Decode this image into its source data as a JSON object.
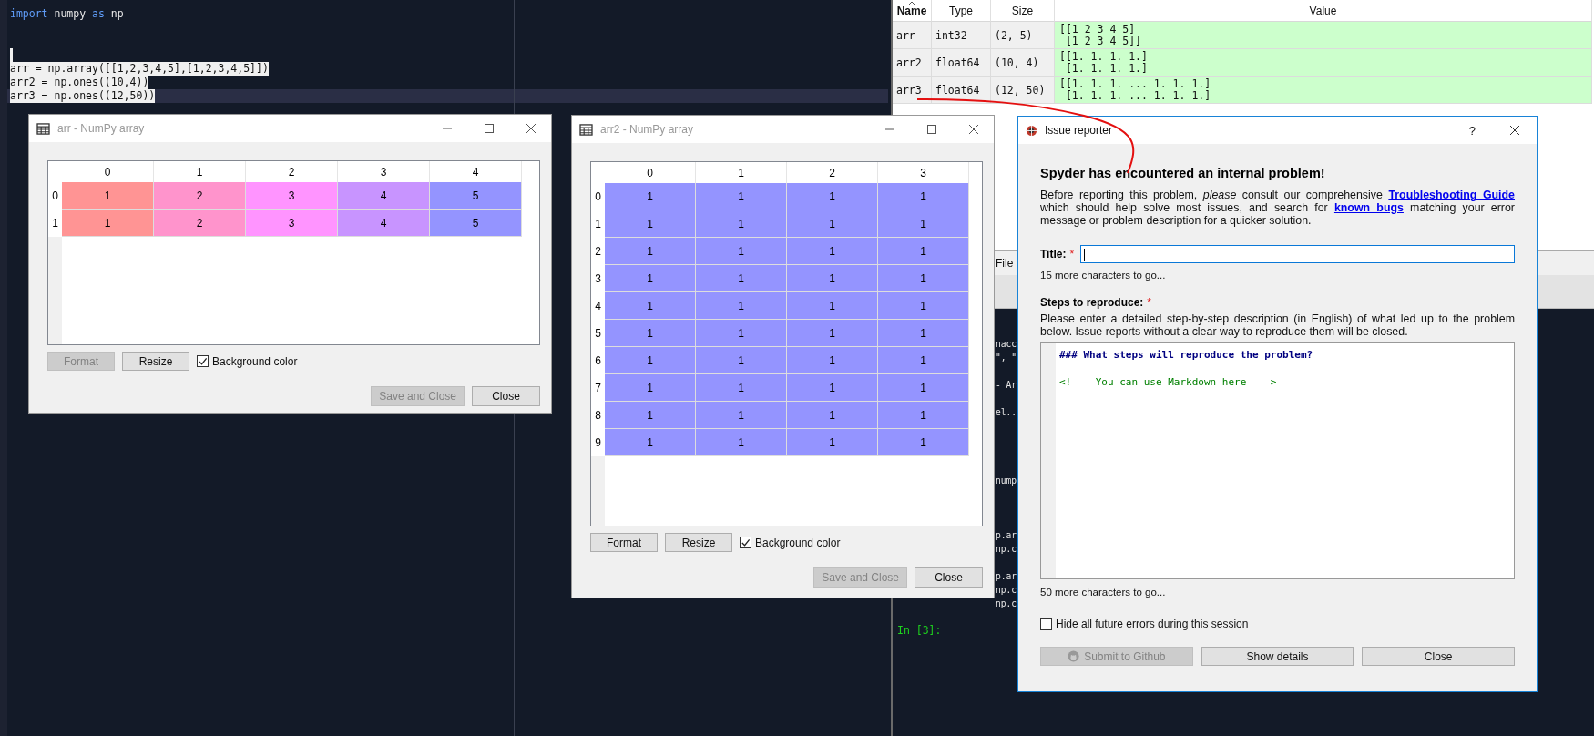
{
  "editor": {
    "lines": [
      {
        "kind": "code",
        "selected": false,
        "current": false,
        "segments": [
          {
            "text": "import",
            "kind": "keyword"
          },
          {
            "text": " numpy ",
            "kind": "plain"
          },
          {
            "text": "as",
            "kind": "keyword"
          },
          {
            "text": " np",
            "kind": "plain"
          }
        ]
      },
      {
        "kind": "blank"
      },
      {
        "kind": "blank"
      },
      {
        "kind": "caret"
      },
      {
        "kind": "code",
        "selected": true,
        "current": false,
        "segments": [
          {
            "text": "arr = np.array([[1,2,3,4,5],[1,2,3,4,5]])",
            "kind": "plain"
          }
        ]
      },
      {
        "kind": "code",
        "selected": true,
        "current": false,
        "segments": [
          {
            "text": "arr2 = np.ones((10,4))",
            "kind": "plain"
          }
        ]
      },
      {
        "kind": "code",
        "selected": true,
        "current": true,
        "segments": [
          {
            "text": "arr3 = np.ones((12,50))",
            "kind": "plain"
          }
        ]
      }
    ]
  },
  "variable_explorer": {
    "columns": [
      {
        "label": "Name",
        "sorted": true
      },
      {
        "label": "Type",
        "sorted": false
      },
      {
        "label": "Size",
        "sorted": false
      },
      {
        "label": "Value",
        "sorted": false
      }
    ],
    "rows": [
      {
        "name": "arr",
        "type": "int32",
        "size": "(2, 5)",
        "value": [
          "[[1 2 3 4 5]",
          " [1 2 3 4 5]]"
        ]
      },
      {
        "name": "arr2",
        "type": "float64",
        "size": "(10, 4)",
        "value": [
          "[[1. 1. 1. 1.]",
          " [1. 1. 1. 1.]"
        ]
      },
      {
        "name": "arr3",
        "type": "float64",
        "size": "(12, 50)",
        "value": [
          "[[1. 1. 1. ... 1. 1. 1.]",
          " [1. 1. 1. ... 1. 1. 1.]"
        ]
      }
    ]
  },
  "console": {
    "tab": "File",
    "lines": [
      {
        "kind": "blank"
      },
      {
        "kind": "fragment",
        "text": "nacc"
      },
      {
        "kind": "fragment",
        "text": "\", \""
      },
      {
        "kind": "blank"
      },
      {
        "kind": "fragment",
        "text": "- Ar"
      },
      {
        "kind": "blank"
      },
      {
        "kind": "fragment",
        "text": "el.."
      },
      {
        "kind": "blank"
      },
      {
        "kind": "blank"
      },
      {
        "kind": "blank"
      },
      {
        "kind": "blank"
      },
      {
        "kind": "fragment",
        "text": "nump"
      },
      {
        "kind": "blank"
      },
      {
        "kind": "blank"
      },
      {
        "kind": "blank"
      },
      {
        "kind": "fragment",
        "text": "p.ar"
      },
      {
        "kind": "fragment",
        "text": "np.c"
      },
      {
        "kind": "blank"
      },
      {
        "kind": "fragment",
        "text": "p.ar"
      },
      {
        "kind": "fragment",
        "text": "np.c"
      },
      {
        "kind": "fragment",
        "text": "np.c"
      },
      {
        "kind": "blank"
      },
      {
        "kind": "prompt",
        "text": "In [3]:"
      }
    ]
  },
  "array_editors": [
    {
      "title": "arr - NumPy array",
      "columns": [
        "0",
        "1",
        "2",
        "3",
        "4"
      ],
      "rows": [
        {
          "label": "0",
          "cells": [
            {
              "text": "1",
              "color": "#ff9494"
            },
            {
              "text": "2",
              "color": "#ff94cc"
            },
            {
              "text": "3",
              "color": "#ff94ff"
            },
            {
              "text": "4",
              "color": "#c894ff"
            },
            {
              "text": "5",
              "color": "#9494ff"
            }
          ]
        },
        {
          "label": "1",
          "cells": [
            {
              "text": "1",
              "color": "#ff9494"
            },
            {
              "text": "2",
              "color": "#ff94cc"
            },
            {
              "text": "3",
              "color": "#ff94ff"
            },
            {
              "text": "4",
              "color": "#c894ff"
            },
            {
              "text": "5",
              "color": "#9494ff"
            }
          ]
        }
      ],
      "buttons": [
        {
          "label": "Format",
          "disabled": true
        },
        {
          "label": "Resize",
          "disabled": false
        }
      ],
      "background_color": {
        "label": "Background color",
        "checked": true
      },
      "footer_buttons": [
        {
          "label": "Save and Close",
          "disabled": true
        },
        {
          "label": "Close",
          "disabled": false
        }
      ]
    },
    {
      "title": "arr2 - NumPy array",
      "columns": [
        "0",
        "1",
        "2",
        "3"
      ],
      "rows": [
        {
          "label": "0",
          "cells": [
            {
              "text": "1",
              "color": "#9494ff"
            },
            {
              "text": "1",
              "color": "#9494ff"
            },
            {
              "text": "1",
              "color": "#9494ff"
            },
            {
              "text": "1",
              "color": "#9494ff"
            }
          ]
        },
        {
          "label": "1",
          "cells": [
            {
              "text": "1",
              "color": "#9494ff"
            },
            {
              "text": "1",
              "color": "#9494ff"
            },
            {
              "text": "1",
              "color": "#9494ff"
            },
            {
              "text": "1",
              "color": "#9494ff"
            }
          ]
        },
        {
          "label": "2",
          "cells": [
            {
              "text": "1",
              "color": "#9494ff"
            },
            {
              "text": "1",
              "color": "#9494ff"
            },
            {
              "text": "1",
              "color": "#9494ff"
            },
            {
              "text": "1",
              "color": "#9494ff"
            }
          ]
        },
        {
          "label": "3",
          "cells": [
            {
              "text": "1",
              "color": "#9494ff"
            },
            {
              "text": "1",
              "color": "#9494ff"
            },
            {
              "text": "1",
              "color": "#9494ff"
            },
            {
              "text": "1",
              "color": "#9494ff"
            }
          ]
        },
        {
          "label": "4",
          "cells": [
            {
              "text": "1",
              "color": "#9494ff"
            },
            {
              "text": "1",
              "color": "#9494ff"
            },
            {
              "text": "1",
              "color": "#9494ff"
            },
            {
              "text": "1",
              "color": "#9494ff"
            }
          ]
        },
        {
          "label": "5",
          "cells": [
            {
              "text": "1",
              "color": "#9494ff"
            },
            {
              "text": "1",
              "color": "#9494ff"
            },
            {
              "text": "1",
              "color": "#9494ff"
            },
            {
              "text": "1",
              "color": "#9494ff"
            }
          ]
        },
        {
          "label": "6",
          "cells": [
            {
              "text": "1",
              "color": "#9494ff"
            },
            {
              "text": "1",
              "color": "#9494ff"
            },
            {
              "text": "1",
              "color": "#9494ff"
            },
            {
              "text": "1",
              "color": "#9494ff"
            }
          ]
        },
        {
          "label": "7",
          "cells": [
            {
              "text": "1",
              "color": "#9494ff"
            },
            {
              "text": "1",
              "color": "#9494ff"
            },
            {
              "text": "1",
              "color": "#9494ff"
            },
            {
              "text": "1",
              "color": "#9494ff"
            }
          ]
        },
        {
          "label": "8",
          "cells": [
            {
              "text": "1",
              "color": "#9494ff"
            },
            {
              "text": "1",
              "color": "#9494ff"
            },
            {
              "text": "1",
              "color": "#9494ff"
            },
            {
              "text": "1",
              "color": "#9494ff"
            }
          ]
        },
        {
          "label": "9",
          "cells": [
            {
              "text": "1",
              "color": "#9494ff"
            },
            {
              "text": "1",
              "color": "#9494ff"
            },
            {
              "text": "1",
              "color": "#9494ff"
            },
            {
              "text": "1",
              "color": "#9494ff"
            }
          ]
        }
      ],
      "buttons": [
        {
          "label": "Format",
          "disabled": false
        },
        {
          "label": "Resize",
          "disabled": false
        }
      ],
      "background_color": {
        "label": "Background color",
        "checked": true
      },
      "footer_buttons": [
        {
          "label": "Save and Close",
          "disabled": true
        },
        {
          "label": "Close",
          "disabled": false
        }
      ]
    }
  ],
  "issue_reporter": {
    "title": "Issue reporter",
    "help": "?",
    "heading": "Spyder has encountered an internal problem!",
    "intro": [
      {
        "kind": "text",
        "text": "Before reporting this problem, "
      },
      {
        "kind": "italic",
        "text": "please"
      },
      {
        "kind": "text",
        "text": " consult our comprehensive "
      },
      {
        "kind": "link",
        "text": "Troubleshooting Guide"
      },
      {
        "kind": "text",
        "text": " which should help solve most issues, and search for "
      },
      {
        "kind": "link",
        "text": "known bugs"
      },
      {
        "kind": "text",
        "text": " matching your error message or problem description for a quicker solution."
      }
    ],
    "title_field": {
      "label": "Title:",
      "required_mark": "*",
      "focused": true,
      "hint": "15 more characters to go..."
    },
    "steps": {
      "label": "Steps to reproduce:",
      "required_mark": "*",
      "description": "Please enter a detailed step-by-step description (in English) of what led up to the problem below. Issue reports without a clear way to reproduce them will be closed.",
      "editor_lines": [
        {
          "kind": "heading",
          "text": "### What steps will reproduce the problem?"
        },
        {
          "kind": "blank"
        },
        {
          "kind": "comment",
          "text": "<!--- You can use Markdown here --->"
        }
      ],
      "hint": "50 more characters to go..."
    },
    "hide_errors": {
      "label": "Hide all future errors during this session",
      "checked": false
    },
    "buttons": [
      {
        "label": "Submit to Github",
        "disabled": true,
        "kind": "github"
      },
      {
        "label": "Show details",
        "disabled": false,
        "kind": "plain"
      },
      {
        "label": "Close",
        "disabled": false,
        "kind": "plain"
      }
    ]
  }
}
